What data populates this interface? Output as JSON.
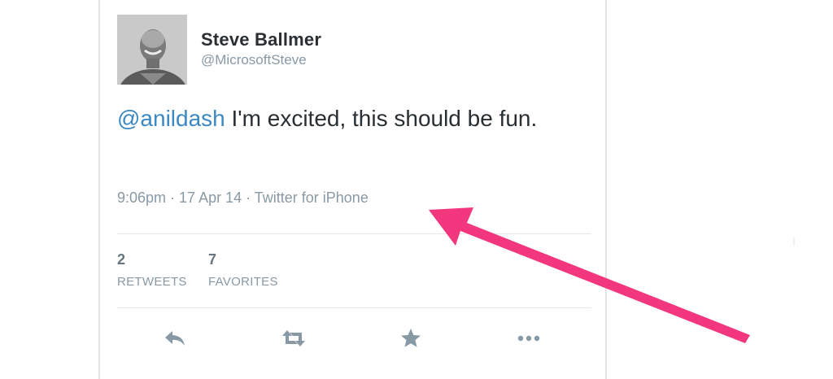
{
  "tweet": {
    "author": {
      "name": "Steve Ballmer",
      "handle": "@MicrosoftSteve"
    },
    "mention": "@anildash",
    "text": " I'm excited, this should be fun.",
    "meta": "9:06pm · 17 Apr 14 · Twitter for iPhone",
    "stats": {
      "retweets": {
        "count": "2",
        "label": "RETWEETS"
      },
      "favorites": {
        "count": "7",
        "label": "FAVORITES"
      }
    },
    "actions": [
      "reply-icon",
      "retweet-icon",
      "favorite-star-icon",
      "more-ellipsis-icon"
    ]
  },
  "colors": {
    "mention": "#3b88c3",
    "text": "#292f33",
    "muted": "#8899a6",
    "icon": "#8899a6",
    "annotation_arrow": "#f2377f"
  }
}
